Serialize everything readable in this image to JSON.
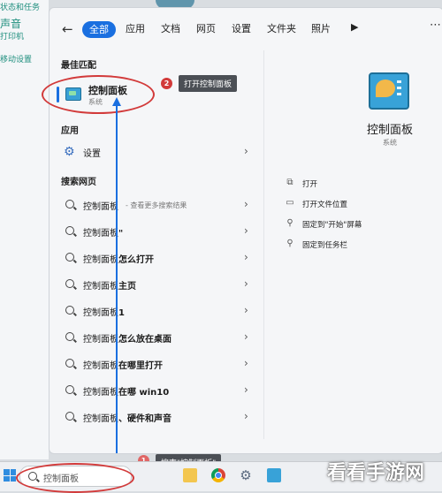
{
  "background_labels": [
    "状态和任务",
    "声音",
    "打印机",
    "移动设置"
  ],
  "tabs": [
    "全部",
    "应用",
    "文档",
    "网页",
    "设置",
    "文件夹",
    "照片"
  ],
  "sections": {
    "best_match": "最佳匹配",
    "apps": "应用",
    "web": "搜索网页"
  },
  "best_match": {
    "name": "控制面板",
    "sub": "系统"
  },
  "apps": [
    {
      "label": "设置"
    }
  ],
  "web_results": [
    {
      "prefix": "控制面板",
      "suffix": "",
      "hint": "- 查看更多搜索结果"
    },
    {
      "prefix": "控制面板",
      "suffix": "\"",
      "hint": ""
    },
    {
      "prefix": "控制面板",
      "suffix": "怎么打开",
      "hint": ""
    },
    {
      "prefix": "控制面板",
      "suffix": "主页",
      "hint": ""
    },
    {
      "prefix": "控制面板",
      "suffix": "1",
      "hint": ""
    },
    {
      "prefix": "控制面板",
      "suffix": "怎么放在桌面",
      "hint": ""
    },
    {
      "prefix": "控制面板",
      "suffix": "在哪里打开",
      "hint": ""
    },
    {
      "prefix": "控制面板",
      "suffix": "在哪 win10",
      "hint": ""
    },
    {
      "prefix": "控制面板",
      "suffix": "、硬件和声音",
      "hint": ""
    }
  ],
  "right_panel": {
    "title": "控制面板",
    "subtitle": "系统",
    "actions": [
      "打开",
      "打开文件位置",
      "固定到\"开始\"屏幕",
      "固定到任务栏"
    ]
  },
  "annotations": {
    "badge1": "1",
    "tip1": "搜索\"控制面板\"",
    "badge2": "2",
    "tip2": "打开控制面板"
  },
  "taskbar": {
    "search_text": "控制面板"
  },
  "watermark": "看看手游网",
  "colors": {
    "accent": "#1a6fe0",
    "annotation": "#d23a3a"
  }
}
